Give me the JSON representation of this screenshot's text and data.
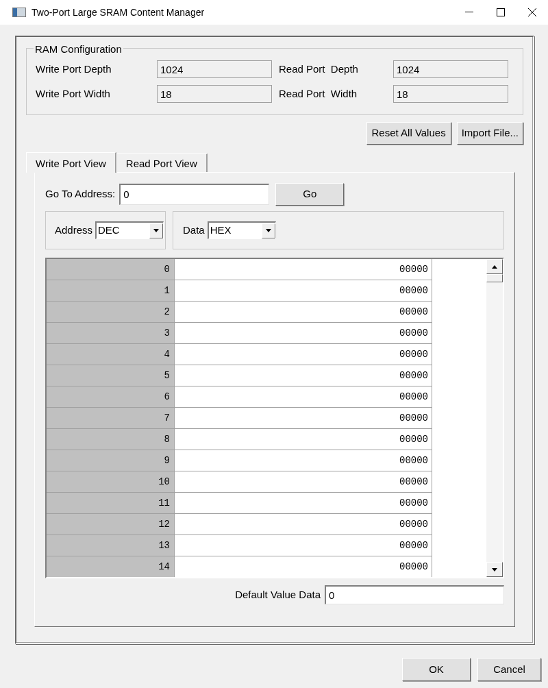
{
  "window": {
    "title": "Two-Port Large SRAM Content Manager"
  },
  "ram_configuration": {
    "title": "RAM Configuration",
    "fields": [
      {
        "label": "Write Port Depth",
        "value": "1024"
      },
      {
        "label": "Read Port  Depth",
        "value": "1024"
      },
      {
        "label": "Write Port Width",
        "value": "18"
      },
      {
        "label": "Read Port  Width",
        "value": "18"
      }
    ]
  },
  "actions": [
    "Reset All Values",
    "Import File..."
  ],
  "tabs": [
    {
      "label": "Write Port View",
      "selected": true
    },
    {
      "label": "Read Port View",
      "selected": false
    }
  ],
  "goto": {
    "label": "Go To Address:",
    "value": "0",
    "button": "Go"
  },
  "address_format": {
    "label": "Address",
    "value": "DEC"
  },
  "data_format": {
    "label": "Data",
    "value": "HEX"
  },
  "rows": [
    {
      "address": "0",
      "data": "00000"
    },
    {
      "address": "1",
      "data": "00000"
    },
    {
      "address": "2",
      "data": "00000"
    },
    {
      "address": "3",
      "data": "00000"
    },
    {
      "address": "4",
      "data": "00000"
    },
    {
      "address": "5",
      "data": "00000"
    },
    {
      "address": "6",
      "data": "00000"
    },
    {
      "address": "7",
      "data": "00000"
    },
    {
      "address": "8",
      "data": "00000"
    },
    {
      "address": "9",
      "data": "00000"
    },
    {
      "address": "10",
      "data": "00000"
    },
    {
      "address": "11",
      "data": "00000"
    },
    {
      "address": "12",
      "data": "00000"
    },
    {
      "address": "13",
      "data": "00000"
    },
    {
      "address": "14",
      "data": "00000"
    }
  ],
  "default_value": {
    "label": "Default Value Data",
    "value": "0"
  },
  "buttons": [
    "OK",
    "Cancel"
  ]
}
